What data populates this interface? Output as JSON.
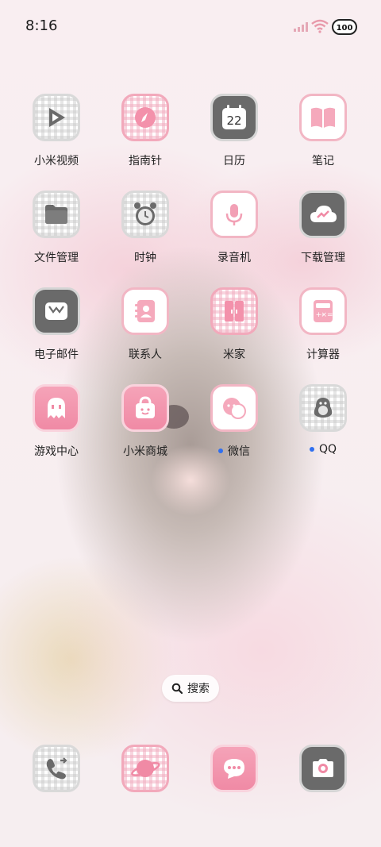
{
  "status": {
    "time": "8:16",
    "battery": "100"
  },
  "apps": [
    {
      "label": "小米视频",
      "icon": "play-icon",
      "style": "check"
    },
    {
      "label": "指南针",
      "icon": "compass-icon",
      "style": "pinkcheck"
    },
    {
      "label": "日历",
      "icon": "calendar-icon",
      "style": "dark",
      "badge": "22"
    },
    {
      "label": "笔记",
      "icon": "book-icon",
      "style": "white"
    },
    {
      "label": "文件管理",
      "icon": "folder-icon",
      "style": "check"
    },
    {
      "label": "时钟",
      "icon": "alarm-clock-icon",
      "style": "check"
    },
    {
      "label": "录音机",
      "icon": "microphone-icon",
      "style": "white"
    },
    {
      "label": "下载管理",
      "icon": "cloud-download-icon",
      "style": "dark"
    },
    {
      "label": "电子邮件",
      "icon": "mail-icon",
      "style": "dark"
    },
    {
      "label": "联系人",
      "icon": "contact-icon",
      "style": "white"
    },
    {
      "label": "米家",
      "icon": "door-icon",
      "style": "pinkcheck"
    },
    {
      "label": "计算器",
      "icon": "calculator-icon",
      "style": "white"
    },
    {
      "label": "游戏中心",
      "icon": "ghost-icon",
      "style": "pink"
    },
    {
      "label": "小米商城",
      "icon": "shopping-bag-icon",
      "style": "pink"
    },
    {
      "label": "微信",
      "icon": "chat-bubbles-icon",
      "style": "white",
      "dot": true
    },
    {
      "label": "QQ",
      "icon": "penguin-icon",
      "style": "check",
      "dot": true
    }
  ],
  "search": {
    "label": "搜索"
  },
  "dock": [
    {
      "icon": "phone-icon"
    },
    {
      "icon": "planet-browser-icon"
    },
    {
      "icon": "message-icon"
    },
    {
      "icon": "camera-icon"
    }
  ]
}
